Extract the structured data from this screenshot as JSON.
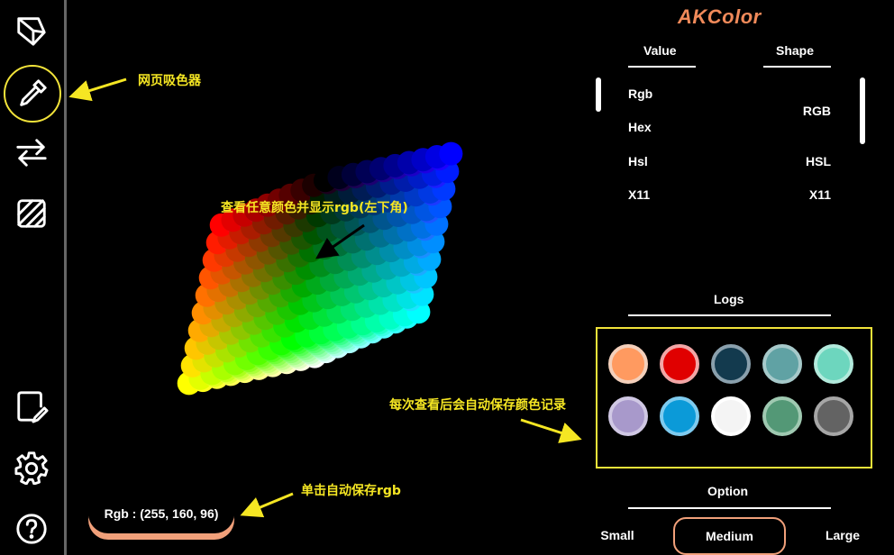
{
  "brand": "AKColor",
  "sidebar": {
    "items": [
      {
        "name": "cube-view-icon"
      },
      {
        "name": "eyedropper-icon",
        "active": true
      },
      {
        "name": "swap-icon"
      },
      {
        "name": "palette-icon"
      },
      {
        "name": "notes-icon"
      },
      {
        "name": "settings-icon"
      },
      {
        "name": "help-icon"
      }
    ]
  },
  "annotations": {
    "picker": "网页吸色器",
    "cube": "查看任意颜色并显示rgb(左下角)",
    "logs": "每次查看后会自动保存颜色记录",
    "pill": "单击自动保存rgb"
  },
  "status": {
    "rgb_text": "Rgb : (255, 160, 96)"
  },
  "panel": {
    "value_tab": "Value",
    "shape_tab": "Shape",
    "values": [
      "Rgb",
      "Hex",
      "Hsl",
      "X11"
    ],
    "shapes": [
      "RGB",
      "HSL",
      "X11"
    ],
    "logs_title": "Logs",
    "option_title": "Option",
    "options": [
      "Small",
      "Medium",
      "Large"
    ],
    "selected_option": "Medium"
  },
  "logs": {
    "colors": [
      "#ff9a60",
      "#e00000",
      "#133a4e",
      "#60a2a4",
      "#6dd6be",
      "#a899cb",
      "#0b9ad8",
      "#f4f4f4",
      "#539876",
      "#636363"
    ],
    "borders": [
      "#f4d0bb",
      "#f2a6a6",
      "#8aa0ad",
      "#a6c9ca",
      "#b2eadc",
      "#d0c8e4",
      "#7ecbef",
      "#ffffff",
      "#9fc9b1",
      "#a6a6a6"
    ]
  },
  "colors": {
    "accent": "#f1a07a",
    "annotation": "#f5e623",
    "highlight_border": "#f2e33a"
  }
}
